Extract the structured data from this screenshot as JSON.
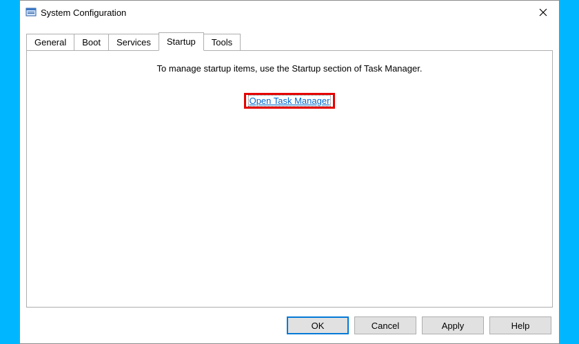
{
  "window": {
    "title": "System Configuration"
  },
  "tabs": {
    "general": "General",
    "boot": "Boot",
    "services": "Services",
    "startup": "Startup",
    "tools": "Tools",
    "active": "startup"
  },
  "startup_panel": {
    "message": "To manage startup items, use the Startup section of Task Manager.",
    "link_text": "Open Task Manager"
  },
  "buttons": {
    "ok": "OK",
    "cancel": "Cancel",
    "apply": "Apply",
    "help": "Help"
  }
}
